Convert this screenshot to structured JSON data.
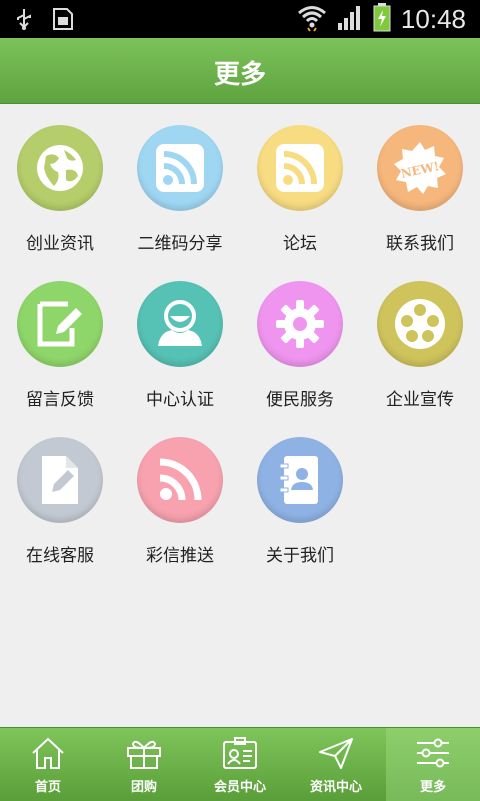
{
  "status_bar": {
    "time": "10:48",
    "icons": [
      "usb-icon",
      "sim-icon",
      "wifi-icon",
      "signal-icon",
      "battery-icon"
    ]
  },
  "header": {
    "title": "更多"
  },
  "grid": {
    "items": [
      {
        "label": "创业资讯",
        "icon": "globe-icon",
        "color": "#b5cd6a"
      },
      {
        "label": "二维码分享",
        "icon": "rss-icon",
        "color": "#9fd7f3"
      },
      {
        "label": "论坛",
        "icon": "rss-icon",
        "color": "#f8dc82"
      },
      {
        "label": "联系我们",
        "icon": "new-badge-icon",
        "color": "#f6b77d"
      },
      {
        "label": "留言反馈",
        "icon": "edit-icon",
        "color": "#8fd66a"
      },
      {
        "label": "中心认证",
        "icon": "user-icon",
        "color": "#56c2b5"
      },
      {
        "label": "便民服务",
        "icon": "gear-icon",
        "color": "#ef95ef"
      },
      {
        "label": "企业宣传",
        "icon": "film-reel-icon",
        "color": "#cfc35c"
      },
      {
        "label": "在线客服",
        "icon": "document-edit-icon",
        "color": "#c3c9d2"
      },
      {
        "label": "彩信推送",
        "icon": "rss-icon",
        "color": "#f7a2ae"
      },
      {
        "label": "关于我们",
        "icon": "contacts-icon",
        "color": "#8fb2e4"
      }
    ]
  },
  "tab_bar": {
    "tabs": [
      {
        "label": "首页",
        "icon": "home-icon",
        "active": false
      },
      {
        "label": "团购",
        "icon": "gift-icon",
        "active": false
      },
      {
        "label": "会员中心",
        "icon": "member-card-icon",
        "active": false
      },
      {
        "label": "资讯中心",
        "icon": "send-icon",
        "active": false
      },
      {
        "label": "更多",
        "icon": "sliders-icon",
        "active": true
      }
    ]
  }
}
